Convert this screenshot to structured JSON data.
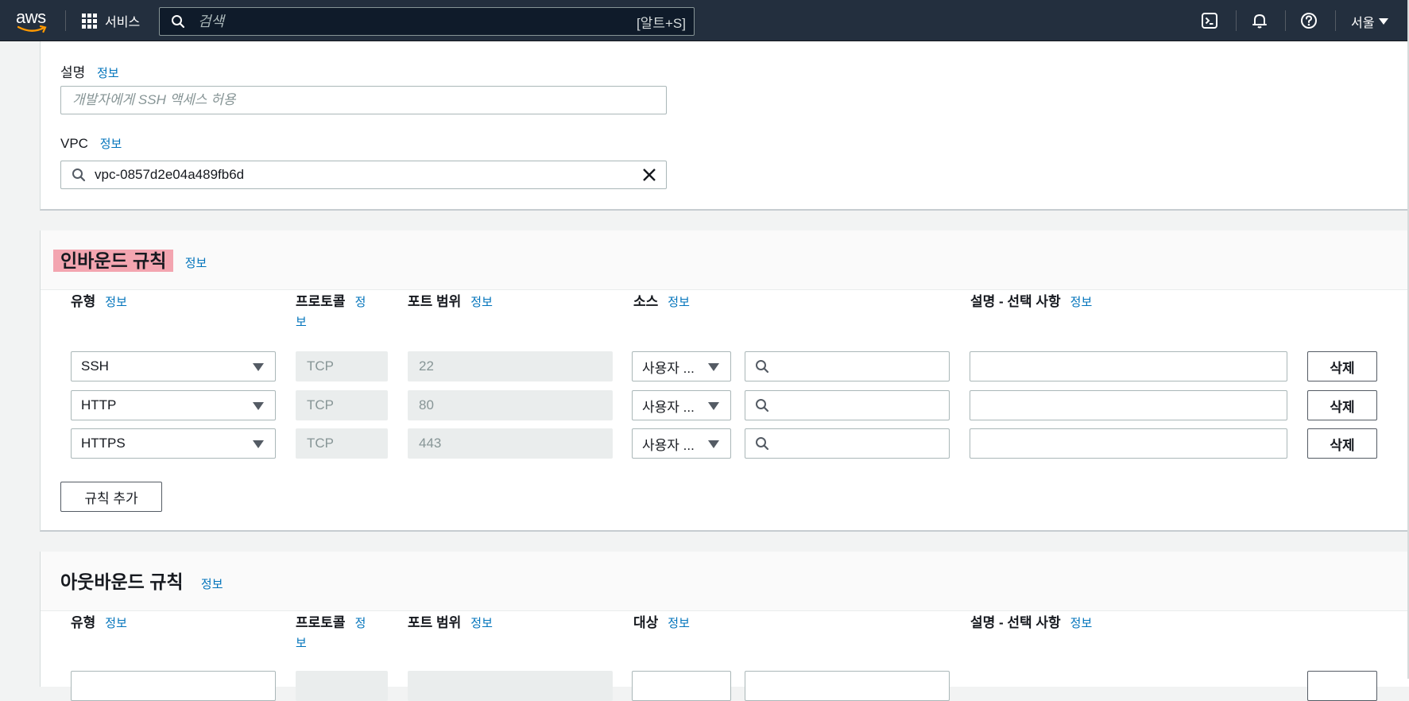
{
  "nav": {
    "logo_text": "aws",
    "services_label": "서비스",
    "search_placeholder": "검색",
    "search_shortcut": "[알트+S]",
    "region_label": "서울",
    "icons": [
      "cloudshell-icon",
      "notifications-bell-icon",
      "help-icon"
    ]
  },
  "basic": {
    "description_label": "설명",
    "description_info": "정보",
    "description_placeholder": "개발자에게 SSH 액세스 허용",
    "vpc_label": "VPC",
    "vpc_info": "정보",
    "vpc_value": "vpc-0857d2e04a489fb6d"
  },
  "inbound": {
    "title": "인바운드 규칙",
    "info": "정보",
    "columns": {
      "type": "유형",
      "protocol_line1": "프로토콜",
      "protocol_info_1": "정",
      "protocol_info_2": "보",
      "port_range": "포트 범위",
      "source": "소스",
      "description": "설명 - 선택 사항",
      "info": "정보"
    },
    "rules": [
      {
        "type": "SSH",
        "protocol": "TCP",
        "port": "22",
        "source": "사용자 ...",
        "delete": "삭제"
      },
      {
        "type": "HTTP",
        "protocol": "TCP",
        "port": "80",
        "source": "사용자 ...",
        "delete": "삭제"
      },
      {
        "type": "HTTPS",
        "protocol": "TCP",
        "port": "443",
        "source": "사용자 ...",
        "delete": "삭제"
      }
    ],
    "add_rule": "규칙 추가"
  },
  "outbound": {
    "title": "아웃바운드 규칙",
    "info": "정보",
    "columns": {
      "type": "유형",
      "protocol_line1": "프로토콜",
      "protocol_info_1": "정",
      "protocol_info_2": "보",
      "port_range": "포트 범위",
      "destination": "대상",
      "description": "설명 - 선택 사항",
      "info": "정보"
    }
  },
  "colors": {
    "nav_bg": "#232f3e",
    "link": "#0073bb",
    "highlight": "#f3a5b0"
  }
}
